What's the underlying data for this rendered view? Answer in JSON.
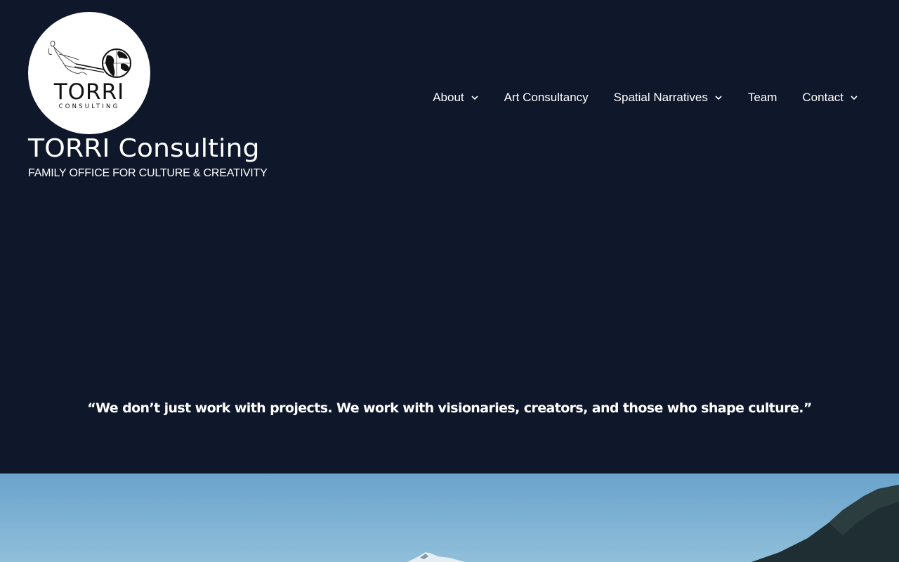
{
  "site": {
    "title": "TORRI Consulting",
    "tagline": "FAMILY OFFICE FOR CULTURE & CREATIVITY",
    "logo": {
      "wordmark": "TORRI",
      "sub_wordmark": "CONSULTING",
      "icon": "figure-pulling-globe-logo"
    }
  },
  "nav": {
    "items": [
      {
        "label": "About",
        "has_dropdown": true
      },
      {
        "label": "Art Consultancy",
        "has_dropdown": false
      },
      {
        "label": "Spatial Narratives",
        "has_dropdown": true
      },
      {
        "label": "Team",
        "has_dropdown": false
      },
      {
        "label": "Contact",
        "has_dropdown": true
      }
    ]
  },
  "hero": {
    "quote": "“We don’t just work with projects. We work with visionaries, creators, and those who shape culture.”",
    "image": "mountain-landscape-image"
  },
  "colors": {
    "background": "#0f172a",
    "text": "#ffffff",
    "sky_top": "#5f98c4",
    "sky_bottom": "#8fbfd9",
    "mountain": "#1d2a2f"
  }
}
